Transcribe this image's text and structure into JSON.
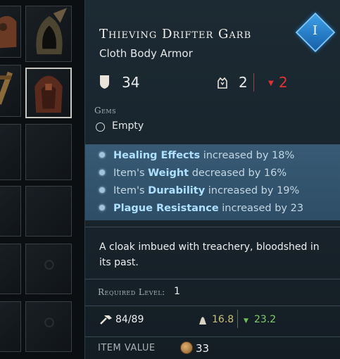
{
  "item": {
    "name": "Thieving Drifter Garb",
    "type": "Cloth Body Armor",
    "tier_badge": "I",
    "armor_value": "34",
    "tier_value": "2",
    "tier_drop": "2",
    "gems_header": "Gems",
    "gem_slot": "Empty",
    "affixes": [
      {
        "pre": "",
        "bold": "Healing Effects",
        "post": " increased by 18%"
      },
      {
        "pre": "Item's ",
        "bold": "Weight",
        "post": " decreased by 16%"
      },
      {
        "pre": "Item's ",
        "bold": "Durability",
        "post": " increased by 19%"
      },
      {
        "pre": "",
        "bold": "Plague Resistance",
        "post": " increased by 23"
      }
    ],
    "flavor": "A cloak imbued with treachery, bloodshed in its past.",
    "required_level_label": "Required Level:",
    "required_level": "1",
    "durability": "84/89",
    "weight": "16.8",
    "weight_reduced": "23.2",
    "item_value_label": "ITEM VALUE",
    "item_value": "33"
  },
  "colors": {
    "badge": "#2a7fcf",
    "affix_highlight": "#aee0ff",
    "negative": "#e03434",
    "positive": "#7fce6a"
  }
}
